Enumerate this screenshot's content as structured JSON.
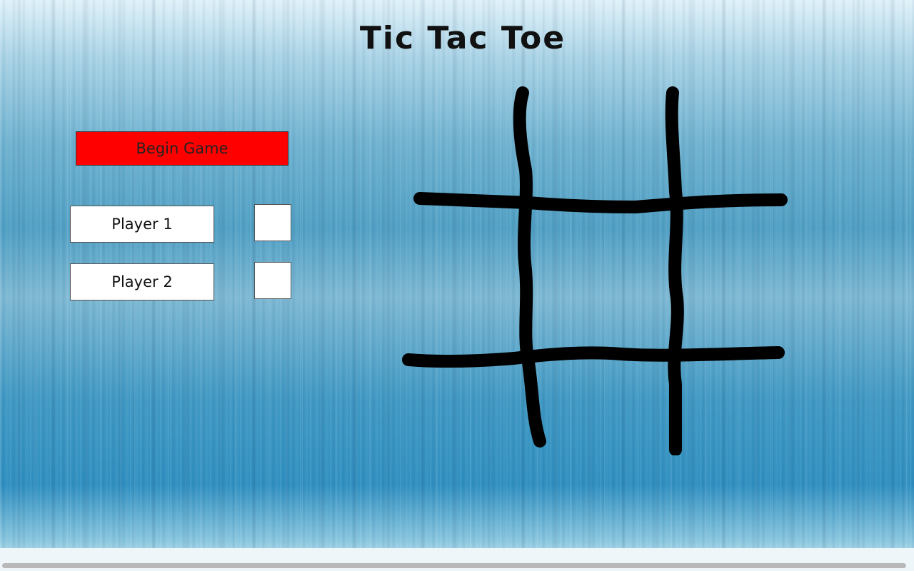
{
  "title": "Tic Tac Toe",
  "begin_button": {
    "label": "Begin Game",
    "color": "#ff0000"
  },
  "players": [
    {
      "label": "Player 1",
      "mark": ""
    },
    {
      "label": "Player 2",
      "mark": ""
    }
  ],
  "board": {
    "cells": [
      "",
      "",
      "",
      "",
      "",
      "",
      "",
      "",
      ""
    ],
    "line_color": "#000000"
  }
}
